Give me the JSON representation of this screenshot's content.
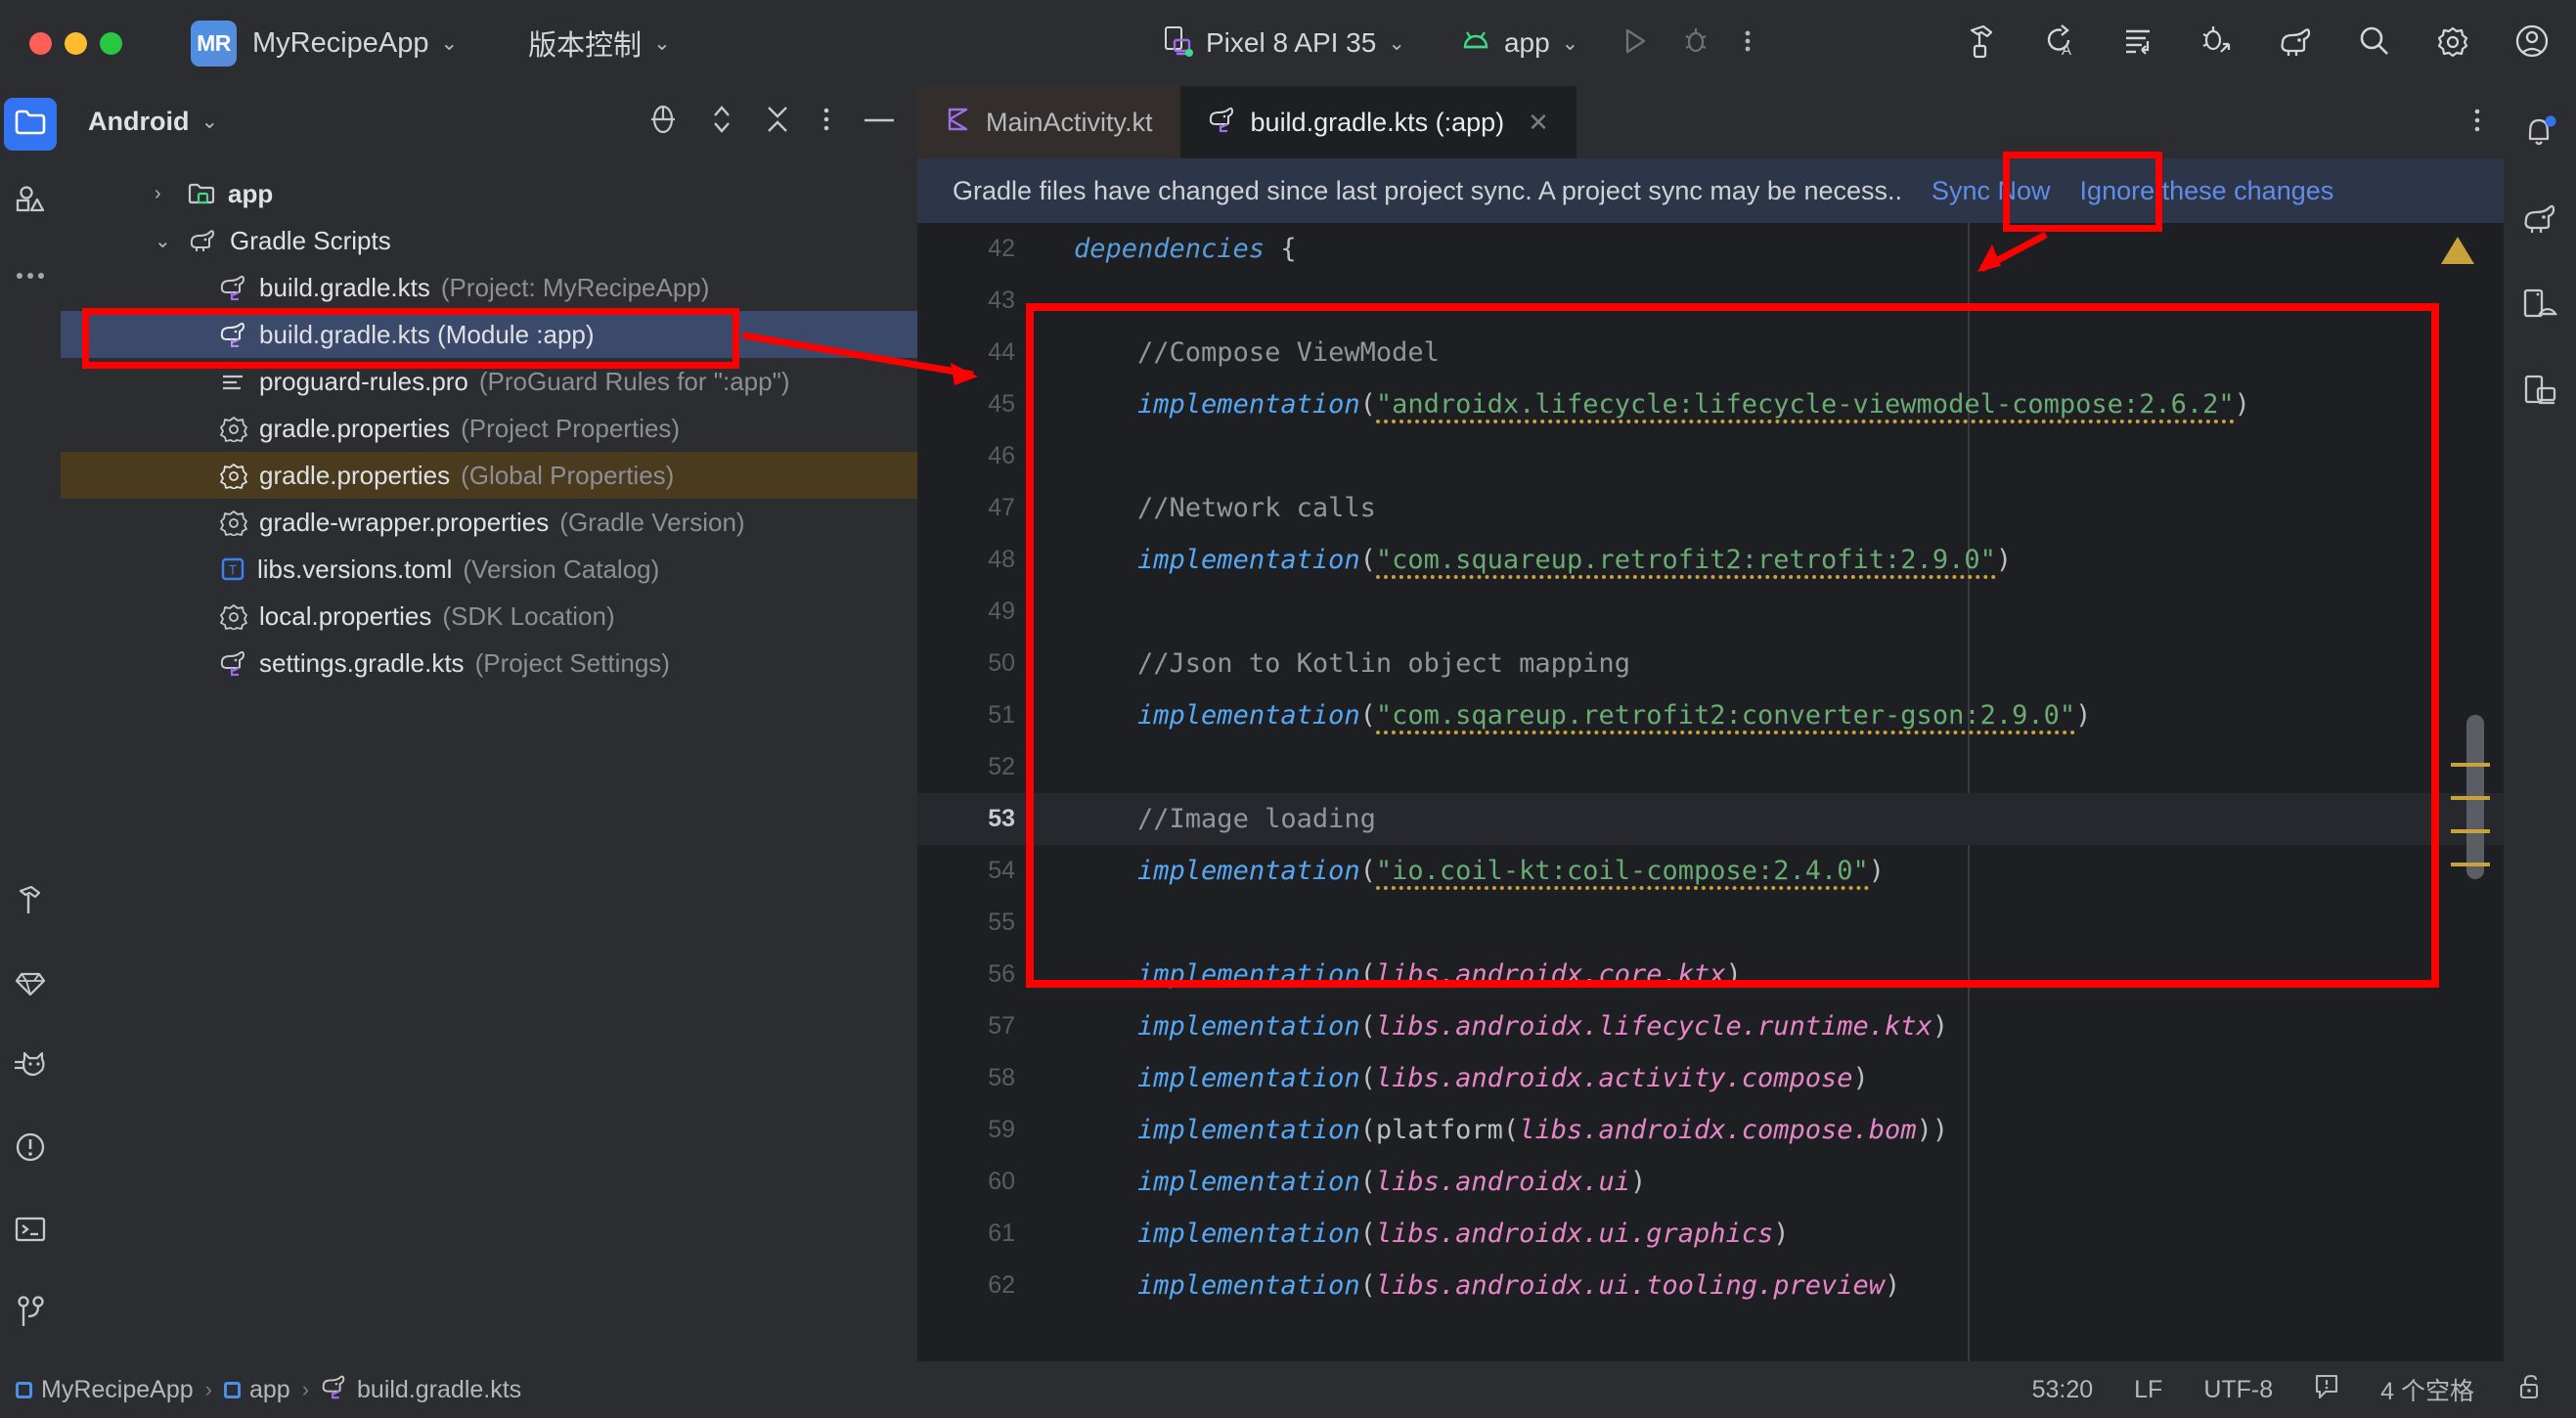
{
  "titlebar": {
    "project_badge": "MR",
    "project_name": "MyRecipeApp",
    "vcs_label": "版本控制",
    "device": "Pixel 8 API 35",
    "run_config": "app",
    "icons": {
      "device": "device-icon",
      "android": "android-icon",
      "run": "run-icon",
      "debug": "debug-icon",
      "more": "more-vertical-icon",
      "build": "hammer-build-icon",
      "apply_changes": "apply-changes-icon",
      "logcat": "logcat-icon",
      "debug_attach": "attach-debugger-icon",
      "gradle": "gradle-elephant-icon",
      "search": "search-icon",
      "settings": "gear-icon",
      "account": "account-icon"
    }
  },
  "left_rail": {
    "items": [
      {
        "name": "project-icon",
        "label": "Project",
        "active": true
      },
      {
        "name": "resource-manager-icon",
        "label": "Resource Manager",
        "active": false
      },
      {
        "name": "more-tool-windows-icon",
        "label": "More Tool Windows",
        "active": false
      }
    ],
    "bottom_items": [
      {
        "name": "build-hammer-icon",
        "label": "Build"
      },
      {
        "name": "gemini-diamond-icon",
        "label": "Gemini"
      },
      {
        "name": "logcat-cat-icon",
        "label": "Logcat"
      },
      {
        "name": "problems-icon",
        "label": "Problems"
      },
      {
        "name": "terminal-icon",
        "label": "Terminal"
      },
      {
        "name": "version-control-icon",
        "label": "Version Control"
      }
    ]
  },
  "right_rail": {
    "items": [
      {
        "name": "notifications-bell-icon",
        "label": "Notifications",
        "badge": true
      },
      {
        "name": "gradle-elephant-icon",
        "label": "Gradle"
      },
      {
        "name": "device-manager-icon",
        "label": "Device Manager"
      },
      {
        "name": "running-devices-icon",
        "label": "Running Devices"
      }
    ]
  },
  "project_panel": {
    "title": "Android",
    "actions": [
      {
        "name": "select-opened-file-icon"
      },
      {
        "name": "expand-collapse-icon"
      },
      {
        "name": "collapse-all-icon"
      },
      {
        "name": "options-menu-icon"
      },
      {
        "name": "hide-panel-icon"
      }
    ],
    "tree": [
      {
        "arrow": "›",
        "icon": "module-folder-icon",
        "name": "app",
        "sub": "",
        "state": "normal",
        "level": 0,
        "bold": true
      },
      {
        "arrow": "⌄",
        "icon": "gradle-elephant-icon",
        "name": "Gradle Scripts",
        "sub": "",
        "state": "normal",
        "level": 0,
        "bold": false
      },
      {
        "arrow": "",
        "icon": "gradle-file-icon",
        "name": "build.gradle.kts",
        "sub": "(Project: MyRecipeApp)",
        "state": "normal",
        "level": 1
      },
      {
        "arrow": "",
        "icon": "gradle-file-icon",
        "name": "build.gradle.kts (Module :app)",
        "sub": "",
        "state": "selected",
        "level": 1
      },
      {
        "arrow": "",
        "icon": "proguard-file-icon",
        "name": "proguard-rules.pro",
        "sub": "(ProGuard Rules for \":app\")",
        "state": "normal",
        "level": 1
      },
      {
        "arrow": "",
        "icon": "properties-file-icon",
        "name": "gradle.properties",
        "sub": "(Project Properties)",
        "state": "normal",
        "level": 1
      },
      {
        "arrow": "",
        "icon": "properties-file-icon",
        "name": "gradle.properties",
        "sub": "(Global Properties)",
        "state": "highlighted",
        "level": 1
      },
      {
        "arrow": "",
        "icon": "properties-file-icon",
        "name": "gradle-wrapper.properties",
        "sub": "(Gradle Version)",
        "state": "normal",
        "level": 1
      },
      {
        "arrow": "",
        "icon": "toml-file-icon",
        "name": "libs.versions.toml",
        "sub": "(Version Catalog)",
        "state": "normal",
        "level": 1
      },
      {
        "arrow": "",
        "icon": "properties-file-icon",
        "name": "local.properties",
        "sub": "(SDK Location)",
        "state": "normal",
        "level": 1
      },
      {
        "arrow": "",
        "icon": "gradle-file-icon",
        "name": "settings.gradle.kts",
        "sub": "(Project Settings)",
        "state": "normal",
        "level": 1
      }
    ]
  },
  "editor": {
    "tabs": [
      {
        "label": "MainActivity.kt",
        "icon": "kotlin-file-icon",
        "active": false,
        "closable": false
      },
      {
        "label": "build.gradle.kts (:app)",
        "icon": "gradle-file-icon",
        "active": true,
        "closable": true
      }
    ],
    "tab_close_glyph": "✕",
    "banner": {
      "message": "Gradle files have changed since last project sync. A project sync may be necess..",
      "sync_label": "Sync Now",
      "ignore_label": "Ignore these changes"
    },
    "code": [
      {
        "num": "42",
        "current": false,
        "tokens": [
          {
            "t": "dependencies",
            "c": "kw"
          },
          {
            "t": " ",
            "c": "plain"
          },
          {
            "t": "{",
            "c": "pnc"
          }
        ]
      },
      {
        "num": "43",
        "current": false,
        "tokens": []
      },
      {
        "num": "44",
        "current": false,
        "tokens": [
          {
            "t": "    ",
            "c": "plain"
          },
          {
            "t": "//Compose ViewModel",
            "c": "cmt"
          }
        ]
      },
      {
        "num": "45",
        "current": false,
        "tokens": [
          {
            "t": "    ",
            "c": "plain"
          },
          {
            "t": "implementation",
            "c": "fn"
          },
          {
            "t": "(",
            "c": "pnc"
          },
          {
            "t": "\"androidx.lifecycle:lifecycle-viewmodel-compose:2.6.2\"",
            "c": "str squig"
          },
          {
            "t": ")",
            "c": "pnc"
          }
        ]
      },
      {
        "num": "46",
        "current": false,
        "tokens": []
      },
      {
        "num": "47",
        "current": false,
        "tokens": [
          {
            "t": "    ",
            "c": "plain"
          },
          {
            "t": "//Network calls",
            "c": "cmt"
          }
        ]
      },
      {
        "num": "48",
        "current": false,
        "tokens": [
          {
            "t": "    ",
            "c": "plain"
          },
          {
            "t": "implementation",
            "c": "fn"
          },
          {
            "t": "(",
            "c": "pnc"
          },
          {
            "t": "\"com.squareup.retrofit2:retrofit:2.9.0\"",
            "c": "str squig"
          },
          {
            "t": ")",
            "c": "pnc"
          }
        ]
      },
      {
        "num": "49",
        "current": false,
        "tokens": []
      },
      {
        "num": "50",
        "current": false,
        "tokens": [
          {
            "t": "    ",
            "c": "plain"
          },
          {
            "t": "//Json to Kotlin object mapping",
            "c": "cmt"
          }
        ]
      },
      {
        "num": "51",
        "current": false,
        "tokens": [
          {
            "t": "    ",
            "c": "plain"
          },
          {
            "t": "implementation",
            "c": "fn"
          },
          {
            "t": "(",
            "c": "pnc"
          },
          {
            "t": "\"com.sqareup.retrofit2:converter-gson:2.9.0\"",
            "c": "str squig"
          },
          {
            "t": ")",
            "c": "pnc"
          }
        ]
      },
      {
        "num": "52",
        "current": false,
        "tokens": []
      },
      {
        "num": "53",
        "current": true,
        "tokens": [
          {
            "t": "    ",
            "c": "plain"
          },
          {
            "t": "//Image loading",
            "c": "cmt"
          }
        ]
      },
      {
        "num": "54",
        "current": false,
        "tokens": [
          {
            "t": "    ",
            "c": "plain"
          },
          {
            "t": "implementation",
            "c": "fn"
          },
          {
            "t": "(",
            "c": "pnc"
          },
          {
            "t": "\"io.coil-kt:coil-compose:2.4.0\"",
            "c": "str squig"
          },
          {
            "t": ")",
            "c": "pnc"
          }
        ]
      },
      {
        "num": "55",
        "current": false,
        "tokens": []
      },
      {
        "num": "56",
        "current": false,
        "tokens": [
          {
            "t": "    ",
            "c": "plain"
          },
          {
            "t": "implementation",
            "c": "fn"
          },
          {
            "t": "(",
            "c": "pnc"
          },
          {
            "t": "libs.androidx.core.ktx",
            "c": "prop"
          },
          {
            "t": ")",
            "c": "pnc"
          }
        ]
      },
      {
        "num": "57",
        "current": false,
        "tokens": [
          {
            "t": "    ",
            "c": "plain"
          },
          {
            "t": "implementation",
            "c": "fn"
          },
          {
            "t": "(",
            "c": "pnc"
          },
          {
            "t": "libs.androidx.lifecycle.runtime.ktx",
            "c": "prop"
          },
          {
            "t": ")",
            "c": "pnc"
          }
        ]
      },
      {
        "num": "58",
        "current": false,
        "tokens": [
          {
            "t": "    ",
            "c": "plain"
          },
          {
            "t": "implementation",
            "c": "fn"
          },
          {
            "t": "(",
            "c": "pnc"
          },
          {
            "t": "libs.androidx.activity.compose",
            "c": "prop"
          },
          {
            "t": ")",
            "c": "pnc"
          }
        ]
      },
      {
        "num": "59",
        "current": false,
        "tokens": [
          {
            "t": "    ",
            "c": "plain"
          },
          {
            "t": "implementation",
            "c": "fn"
          },
          {
            "t": "(",
            "c": "pnc"
          },
          {
            "t": "platform",
            "c": "plain"
          },
          {
            "t": "(",
            "c": "pnc"
          },
          {
            "t": "libs.androidx.compose.bom",
            "c": "prop"
          },
          {
            "t": "))",
            "c": "pnc"
          }
        ]
      },
      {
        "num": "60",
        "current": false,
        "tokens": [
          {
            "t": "    ",
            "c": "plain"
          },
          {
            "t": "implementation",
            "c": "fn"
          },
          {
            "t": "(",
            "c": "pnc"
          },
          {
            "t": "libs.androidx.ui",
            "c": "prop"
          },
          {
            "t": ")",
            "c": "pnc"
          }
        ]
      },
      {
        "num": "61",
        "current": false,
        "tokens": [
          {
            "t": "    ",
            "c": "plain"
          },
          {
            "t": "implementation",
            "c": "fn"
          },
          {
            "t": "(",
            "c": "pnc"
          },
          {
            "t": "libs.androidx.ui.graphics",
            "c": "prop"
          },
          {
            "t": ")",
            "c": "pnc"
          }
        ]
      },
      {
        "num": "62",
        "current": false,
        "tokens": [
          {
            "t": "    ",
            "c": "plain"
          },
          {
            "t": "implementation",
            "c": "fn"
          },
          {
            "t": "(",
            "c": "pnc"
          },
          {
            "t": "libs.androidx.ui.tooling.preview",
            "c": "prop"
          },
          {
            "t": ")",
            "c": "pnc"
          }
        ]
      }
    ]
  },
  "status_bar": {
    "breadcrumbs": [
      {
        "label": "MyRecipeApp",
        "icon": "module-square-icon"
      },
      {
        "label": "app",
        "icon": "module-square-icon"
      },
      {
        "label": "build.gradle.kts",
        "icon": "gradle-file-icon"
      }
    ],
    "separator": "›",
    "caret_position": "53:20",
    "line_ending": "LF",
    "encoding": "UTF-8",
    "indent": "4 个空格",
    "inspection_icon": "inspections-icon",
    "lock_icon": "unlocked-icon"
  },
  "colors": {
    "accent_blue": "#3574f0",
    "annotation_red": "#ff0000",
    "selection_blue": "#3b4a6b",
    "highlight_brown": "#4a3a1e",
    "warning_yellow": "#c8a23a",
    "link_blue": "#5f8ee8"
  }
}
